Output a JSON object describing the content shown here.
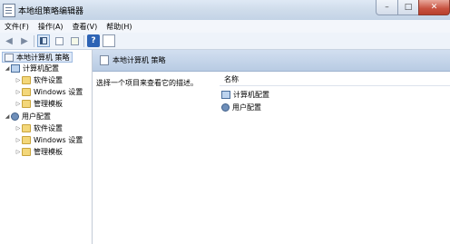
{
  "window": {
    "title": "本地组策略编辑器"
  },
  "window_buttons": {
    "minimize": "–",
    "maximize": "□",
    "close": "✕"
  },
  "menu": [
    "文件(F)",
    "操作(A)",
    "查看(V)",
    "帮助(H)"
  ],
  "toolbar": {
    "back_glyph": "◀",
    "forward_glyph": "▶",
    "help_glyph": "?",
    "icons": [
      "back-icon",
      "forward-icon",
      "show-tree-icon",
      "properties-icon",
      "export-icon",
      "help-icon",
      "view-icon"
    ]
  },
  "tree": {
    "root": "本地计算机 策略",
    "computer_config": "计算机配置",
    "user_config": "用户配置",
    "children": [
      "软件设置",
      "Windows 设置",
      "管理模板"
    ],
    "expanded_glyph": "◢",
    "collapsed_glyph": "▷"
  },
  "content": {
    "header_title": "本地计算机 策略",
    "description": "选择一个项目来查看它的描述。",
    "column_name": "名称",
    "items": [
      "计算机配置",
      "用户配置"
    ]
  }
}
